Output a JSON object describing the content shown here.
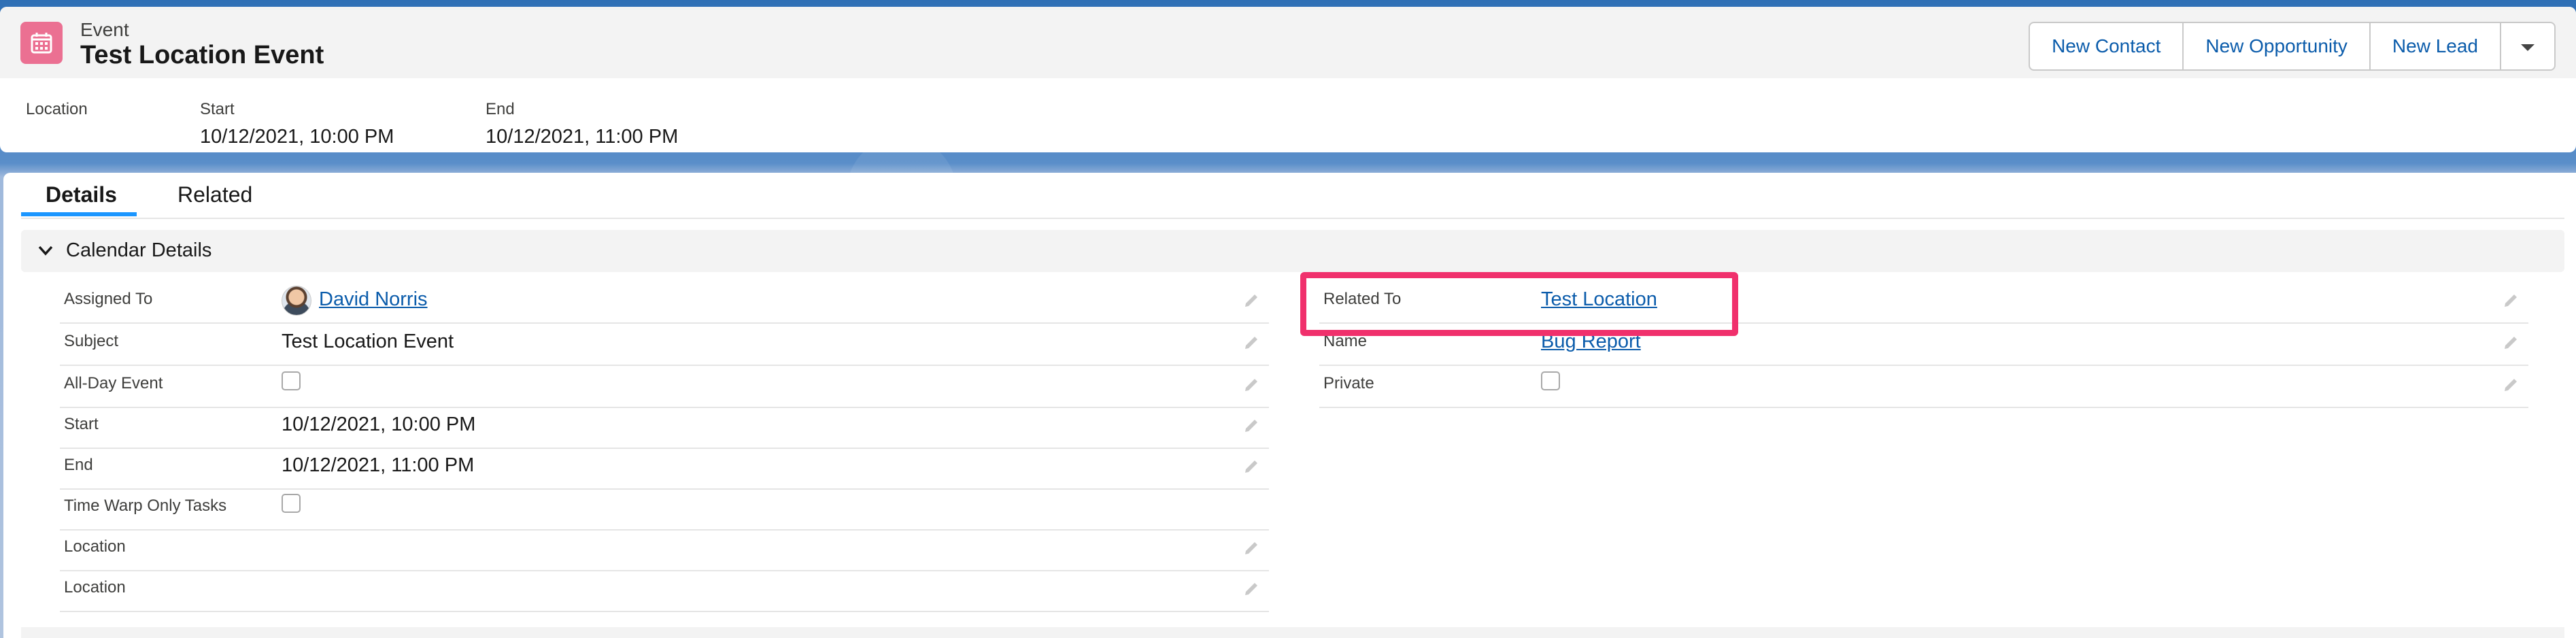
{
  "header": {
    "object_type": "Event",
    "title": "Test Location Event",
    "actions": [
      "New Contact",
      "New Opportunity",
      "New Lead"
    ]
  },
  "highlights": [
    {
      "label": "Location",
      "value": ""
    },
    {
      "label": "Start",
      "value": "10/12/2021, 10:00 PM"
    },
    {
      "label": "End",
      "value": "10/12/2021, 11:00 PM"
    }
  ],
  "tabs": [
    "Details",
    "Related"
  ],
  "section": {
    "title": "Calendar Details"
  },
  "left_fields": [
    {
      "label": "Assigned To",
      "value": "David Norris"
    },
    {
      "label": "Subject",
      "value": "Test Location Event"
    },
    {
      "label": "All-Day Event",
      "checked": false
    },
    {
      "label": "Start",
      "value": "10/12/2021, 10:00 PM"
    },
    {
      "label": "End",
      "value": "10/12/2021, 11:00 PM"
    },
    {
      "label": "Time Warp Only Tasks",
      "checked": false
    },
    {
      "label": "Location",
      "value": ""
    },
    {
      "label": "Location",
      "value": ""
    }
  ],
  "right_fields": [
    {
      "label": "Related To",
      "value": "Test Location"
    },
    {
      "label": "Name",
      "value": "Bug Report"
    },
    {
      "label": "Private",
      "checked": false
    }
  ],
  "colors": {
    "accent": "#0b5cab",
    "highlight": "#f0306c",
    "event_icon": "#eb7092"
  }
}
